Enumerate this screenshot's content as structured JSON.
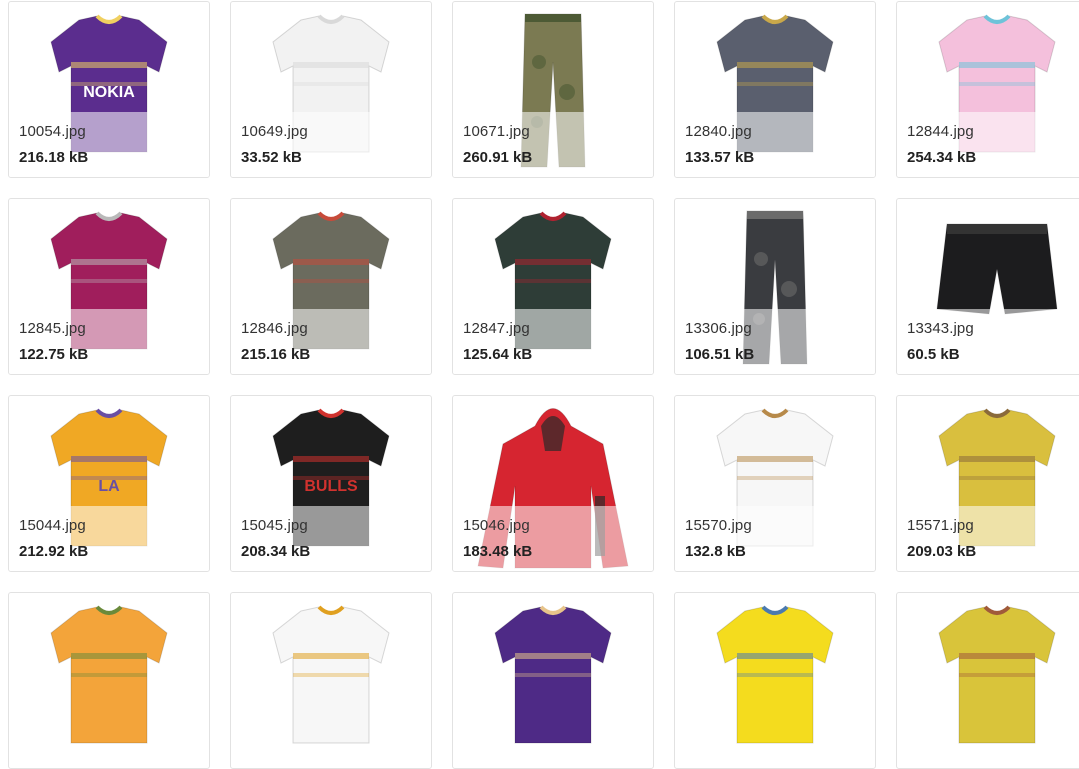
{
  "files": [
    {
      "name": "10054.jpg",
      "size": "216.18 kB",
      "icon": "jersey-icon",
      "color": "#5b2d8e",
      "accent": "#f0d060",
      "kind": "tee",
      "text": "NOKIA"
    },
    {
      "name": "10649.jpg",
      "size": "33.52 kB",
      "icon": "shirt-icon",
      "color": "#f2f2f2",
      "accent": "#d9d9d9",
      "kind": "shirt",
      "text": ""
    },
    {
      "name": "10671.jpg",
      "size": "260.91 kB",
      "icon": "trousers-icon",
      "color": "#7b7a52",
      "accent": "#4d5a35",
      "kind": "pants",
      "text": ""
    },
    {
      "name": "12840.jpg",
      "size": "133.57 kB",
      "icon": "tshirt-icon",
      "color": "#5a5f6e",
      "accent": "#c9a84a",
      "kind": "tee",
      "text": ""
    },
    {
      "name": "12844.jpg",
      "size": "254.34 kB",
      "icon": "polo-icon",
      "color": "#f4c0dc",
      "accent": "#6ec3d9",
      "kind": "tee",
      "text": ""
    },
    {
      "name": "12845.jpg",
      "size": "122.75 kB",
      "icon": "tshirt-icon",
      "color": "#a01e5c",
      "accent": "#b9b9b9",
      "kind": "tee",
      "text": ""
    },
    {
      "name": "12846.jpg",
      "size": "215.16 kB",
      "icon": "tshirt-icon",
      "color": "#6b6b5e",
      "accent": "#c74b3a",
      "kind": "tee",
      "text": ""
    },
    {
      "name": "12847.jpg",
      "size": "125.64 kB",
      "icon": "tshirt-icon",
      "color": "#2e3d37",
      "accent": "#b02230",
      "kind": "tee",
      "text": ""
    },
    {
      "name": "13306.jpg",
      "size": "106.51 kB",
      "icon": "trousers-icon",
      "color": "#3a3c40",
      "accent": "#6b6b6b",
      "kind": "pants",
      "text": ""
    },
    {
      "name": "13343.jpg",
      "size": "60.5 kB",
      "icon": "shorts-icon",
      "color": "#1c1c1e",
      "accent": "#333333",
      "kind": "shorts",
      "text": ""
    },
    {
      "name": "15044.jpg",
      "size": "212.92 kB",
      "icon": "tshirt-icon",
      "color": "#f0a824",
      "accent": "#6a4fa3",
      "kind": "tee",
      "text": "LA"
    },
    {
      "name": "15045.jpg",
      "size": "208.34 kB",
      "icon": "tshirt-icon",
      "color": "#1e1e1e",
      "accent": "#d0322e",
      "kind": "tee",
      "text": "BULLS"
    },
    {
      "name": "15046.jpg",
      "size": "183.48 kB",
      "icon": "hoodie-icon",
      "color": "#d62530",
      "accent": "#2a2a2a",
      "kind": "hoodie",
      "text": ""
    },
    {
      "name": "15570.jpg",
      "size": "132.8 kB",
      "icon": "tshirt-icon",
      "color": "#f7f7f7",
      "accent": "#b78a4a",
      "kind": "tee",
      "text": ""
    },
    {
      "name": "15571.jpg",
      "size": "209.03 kB",
      "icon": "tshirt-icon",
      "color": "#d9bf3e",
      "accent": "#8a6a3a",
      "kind": "tee",
      "text": ""
    },
    {
      "name": "",
      "size": "",
      "icon": "tshirt-icon",
      "color": "#f3a43a",
      "accent": "#6a8a3a",
      "kind": "tee",
      "text": ""
    },
    {
      "name": "",
      "size": "",
      "icon": "tshirt-icon",
      "color": "#f7f7f7",
      "accent": "#e0a020",
      "kind": "tee",
      "text": ""
    },
    {
      "name": "",
      "size": "",
      "icon": "tshirt-icon",
      "color": "#4e2a86",
      "accent": "#e7c48a",
      "kind": "tee",
      "text": ""
    },
    {
      "name": "",
      "size": "",
      "icon": "tshirt-icon",
      "color": "#f4dc1e",
      "accent": "#4a7ab0",
      "kind": "tee",
      "text": ""
    },
    {
      "name": "",
      "size": "",
      "icon": "tshirt-icon",
      "color": "#d9c43a",
      "accent": "#a05a3a",
      "kind": "tee",
      "text": ""
    }
  ]
}
